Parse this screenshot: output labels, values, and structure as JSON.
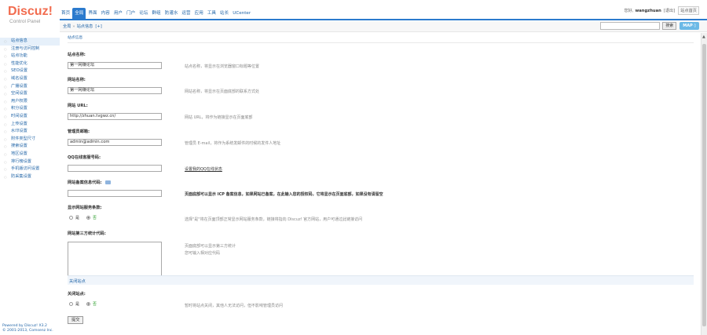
{
  "app": {
    "logo": "Discuz!",
    "logo_sub": "Control Panel"
  },
  "topnav": [
    {
      "label": "首页",
      "active": false
    },
    {
      "label": "全局",
      "active": true
    },
    {
      "label": "界面",
      "active": false
    },
    {
      "label": "内容",
      "active": false
    },
    {
      "label": "用户",
      "active": false
    },
    {
      "label": "门户",
      "active": false
    },
    {
      "label": "论坛",
      "active": false
    },
    {
      "label": "群组",
      "active": false
    },
    {
      "label": "防灌水",
      "active": false
    },
    {
      "label": "运营",
      "active": false
    },
    {
      "label": "应用",
      "active": false
    },
    {
      "label": "工具",
      "active": false
    },
    {
      "label": "站长",
      "active": false
    },
    {
      "label": "UCenter",
      "active": false
    }
  ],
  "user": {
    "greeting": "您好,",
    "name": "wangzhuan",
    "logout": "[退出]",
    "home": "站点首页"
  },
  "breadcrumb": {
    "root": "全局",
    "sep": "»",
    "current": "站点信息",
    "add": "[+]"
  },
  "search": {
    "button": "搜索",
    "map": "MAP ◊"
  },
  "sidebar": {
    "items": [
      {
        "label": "站点信息",
        "active": true
      },
      {
        "label": "注册与访问控制",
        "active": false
      },
      {
        "label": "站点功能",
        "active": false
      },
      {
        "label": "性能优化",
        "active": false
      },
      {
        "label": "SEO设置",
        "active": false
      },
      {
        "label": "域名设置",
        "active": false
      },
      {
        "label": "广播设置",
        "active": false
      },
      {
        "label": "空间设置",
        "active": false
      },
      {
        "label": "用户权限",
        "active": false
      },
      {
        "label": "积分设置",
        "active": false
      },
      {
        "label": "时间设置",
        "active": false
      },
      {
        "label": "上传设置",
        "active": false
      },
      {
        "label": "水印设置",
        "active": false
      },
      {
        "label": "附件类型尺寸",
        "active": false
      },
      {
        "label": "搜索设置",
        "active": false
      },
      {
        "label": "地区设置",
        "active": false
      },
      {
        "label": "排行榜设置",
        "active": false
      },
      {
        "label": "手机版访问设置",
        "active": false
      },
      {
        "label": "防采集设置",
        "active": false
      }
    ],
    "powered_line1": "Powered by Discuz! X3.2",
    "powered_line2": "© 2001-2013, Comsenz Inc."
  },
  "main": {
    "title": "站点信息",
    "fields": {
      "site_name": {
        "label": "站点名称:",
        "value": "第一网赚论坛",
        "hint": "站点名称，将显示在浏览器窗口标题等位置"
      },
      "web_name": {
        "label": "网站名称:",
        "value": "第一网赚论坛",
        "hint": "网站名称，将显示在页面底部的联系方式处"
      },
      "web_url": {
        "label": "网站 URL:",
        "value": "http://zhuan.tvgwz.cn/",
        "hint": "网站 URL，将作为链接显示在页面底部"
      },
      "admin_email": {
        "label": "管理员邮箱:",
        "value": "admin@admin.com",
        "hint": "管理员 E-mail，将作为系统发邮件的时候的发件人地址"
      },
      "qq": {
        "label": "QQ在线客服号码:",
        "value": "",
        "hint": "设置我的QQ在线状态"
      },
      "icp": {
        "label": "网站备案信息代码:",
        "value": "",
        "hint": "页面底部可以显示 ICP 备案信息，如果网站已备案，在此输入您的授权码，它将显示在页面底部，如果没有请留空"
      },
      "bbrules": {
        "label": "显示网站服务条款:",
        "hint": "选择\"是\"将在页面顶部正常显示网站服务条款，链接将指向 Discuz! 官方网站，用户可通过此链接访问"
      },
      "stat_code": {
        "label": "网站第三方统计代码:",
        "hint1": "页面底部可以显示第三方统计",
        "hint2": "您可输入相对应代码"
      },
      "close_section": "关闭站点",
      "close": {
        "label": "关闭站点:",
        "hint": "暂时将站点关闭，其他人无法访问，但不影响管理员访问"
      }
    },
    "radio_yes": "是",
    "radio_no": "否",
    "submit": "提交"
  }
}
